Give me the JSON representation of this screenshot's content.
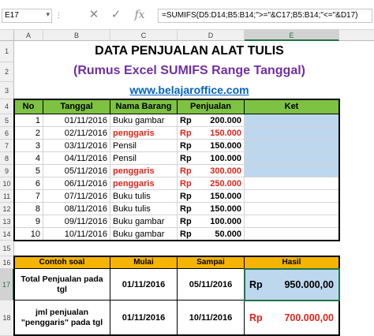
{
  "formula_bar": {
    "name_box": "E17",
    "formula": "=SUMIFS(D5:D14;B5:B14;\">=\"&C17;B5:B14;\"<=\"&D17)",
    "cancel_icon": "close-icon",
    "enter_icon": "check-icon",
    "fx_label": "fx"
  },
  "columns": [
    "A",
    "B",
    "C",
    "D",
    "E"
  ],
  "rows": [
    "1",
    "2",
    "3",
    "4",
    "5",
    "6",
    "7",
    "8",
    "9",
    "10",
    "11",
    "12",
    "13",
    "14",
    "15",
    "16",
    "17",
    "18"
  ],
  "titles": {
    "main": "DATA PENJUALAN ALAT TULIS",
    "sub": "(Rumus Excel SUMIFS Range Tanggal)",
    "link": "www.belajaroffice.com"
  },
  "table": {
    "headers": [
      "No",
      "Tanggal",
      "Nama Barang",
      "Penjualan",
      "Ket"
    ],
    "currency": "Rp",
    "rows": [
      {
        "no": "1",
        "tanggal": "01/11/2016",
        "barang": "Buku gambar",
        "nilai": "200.000"
      },
      {
        "no": "2",
        "tanggal": "02/11/2016",
        "barang": "penggaris",
        "nilai": "150.000"
      },
      {
        "no": "3",
        "tanggal": "03/11/2016",
        "barang": "Pensil",
        "nilai": "150.000"
      },
      {
        "no": "4",
        "tanggal": "04/11/2016",
        "barang": "Pensil",
        "nilai": "100.000"
      },
      {
        "no": "5",
        "tanggal": "05/11/2016",
        "barang": "penggaris",
        "nilai": "300.000"
      },
      {
        "no": "6",
        "tanggal": "06/11/2016",
        "barang": "penggaris",
        "nilai": "250.000"
      },
      {
        "no": "7",
        "tanggal": "07/11/2016",
        "barang": "Buku tulis",
        "nilai": "150.000"
      },
      {
        "no": "8",
        "tanggal": "08/11/2016",
        "barang": "Buku tulis",
        "nilai": "150.000"
      },
      {
        "no": "9",
        "tanggal": "09/11/2016",
        "barang": "Buku gambar",
        "nilai": "100.000"
      },
      {
        "no": "10",
        "tanggal": "10/11/2016",
        "barang": "Buku gambar",
        "nilai": "50.000"
      }
    ]
  },
  "summary": {
    "headers": [
      "Contoh soal",
      "Mulai",
      "Sampai",
      "Hasil"
    ],
    "rows": [
      {
        "soal": "Total Penjualan pada tgl",
        "mulai": "01/11/2016",
        "sampai": "05/11/2016",
        "rp": "Rp",
        "hasil": "950.000,00"
      },
      {
        "soal": "jml penjualan \"penggaris\" pada tgl",
        "mulai": "01/11/2016",
        "sampai": "10/11/2016",
        "rp": "Rp",
        "hasil": "700.000,00"
      }
    ]
  },
  "colors": {
    "header_green": "#7dc242",
    "header_orange": "#f5b400",
    "selection": "#217346",
    "highlight_blue": "#bdd7ee",
    "red_text": "#e2231a",
    "purple_title": "#7030a0"
  }
}
